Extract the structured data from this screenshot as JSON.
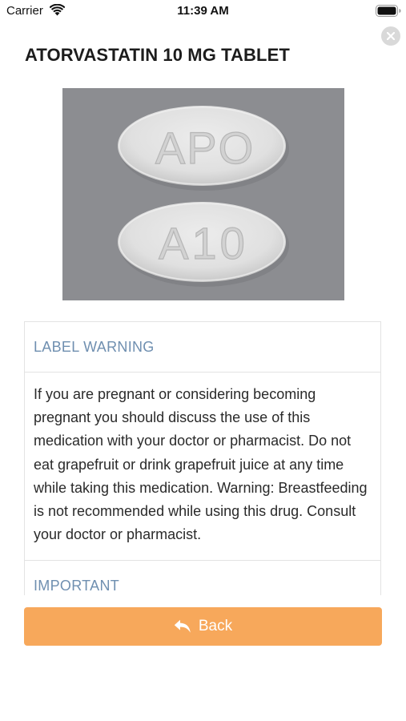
{
  "status_bar": {
    "carrier": "Carrier",
    "time": "11:39 AM",
    "wifi_icon": "wifi-icon",
    "battery_icon": "battery-full-icon"
  },
  "header": {
    "title": "ATORVASTATIN 10 MG TABLET",
    "close_icon": "close-circle-icon"
  },
  "pill_image": {
    "imprint_top": "APO",
    "imprint_bottom": "A10"
  },
  "sections": [
    {
      "heading": "LABEL WARNING",
      "body": "If you are pregnant or considering becoming pregnant you should discuss the use of this medication with your doctor or pharmacist. Do not eat grapefruit or drink grapefruit juice at any time while taking this medication. Warning: Breastfeeding is not recommended while using this drug. Consult your doctor or pharmacist."
    },
    {
      "heading": "IMPORTANT"
    }
  ],
  "back_button": {
    "label": "Back",
    "icon": "reply-arrow-icon"
  },
  "colors": {
    "accent_orange": "#f7a85b",
    "section_heading": "#6f8fb0",
    "image_background": "#8c8d91"
  }
}
